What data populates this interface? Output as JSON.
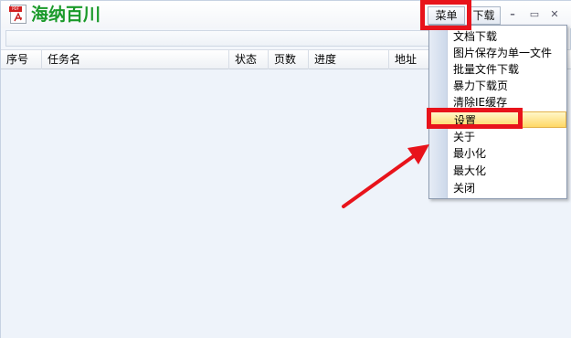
{
  "app": {
    "title": "海纳百川",
    "icon_label": "PDF"
  },
  "titlebar": {
    "menu_label": "菜单",
    "download_label": "下载",
    "minimize_glyph": "–",
    "maximize_glyph": "▭",
    "close_glyph": "✕"
  },
  "list": {
    "columns": [
      "序号",
      "任务名",
      "状态",
      "页数",
      "进度",
      "地址"
    ]
  },
  "menu": {
    "items": [
      "文档下载",
      "图片保存为单一文件",
      "批量文件下载",
      "暴力下载页",
      "清除IE缓存",
      "设置",
      "关于",
      "最小化",
      "最大化",
      "关闭"
    ],
    "highlighted_item": "设置"
  },
  "colors": {
    "title_green": "#1a9a2a",
    "annotation_red": "#e8131b",
    "highlight_yellow": "#ffd865"
  }
}
